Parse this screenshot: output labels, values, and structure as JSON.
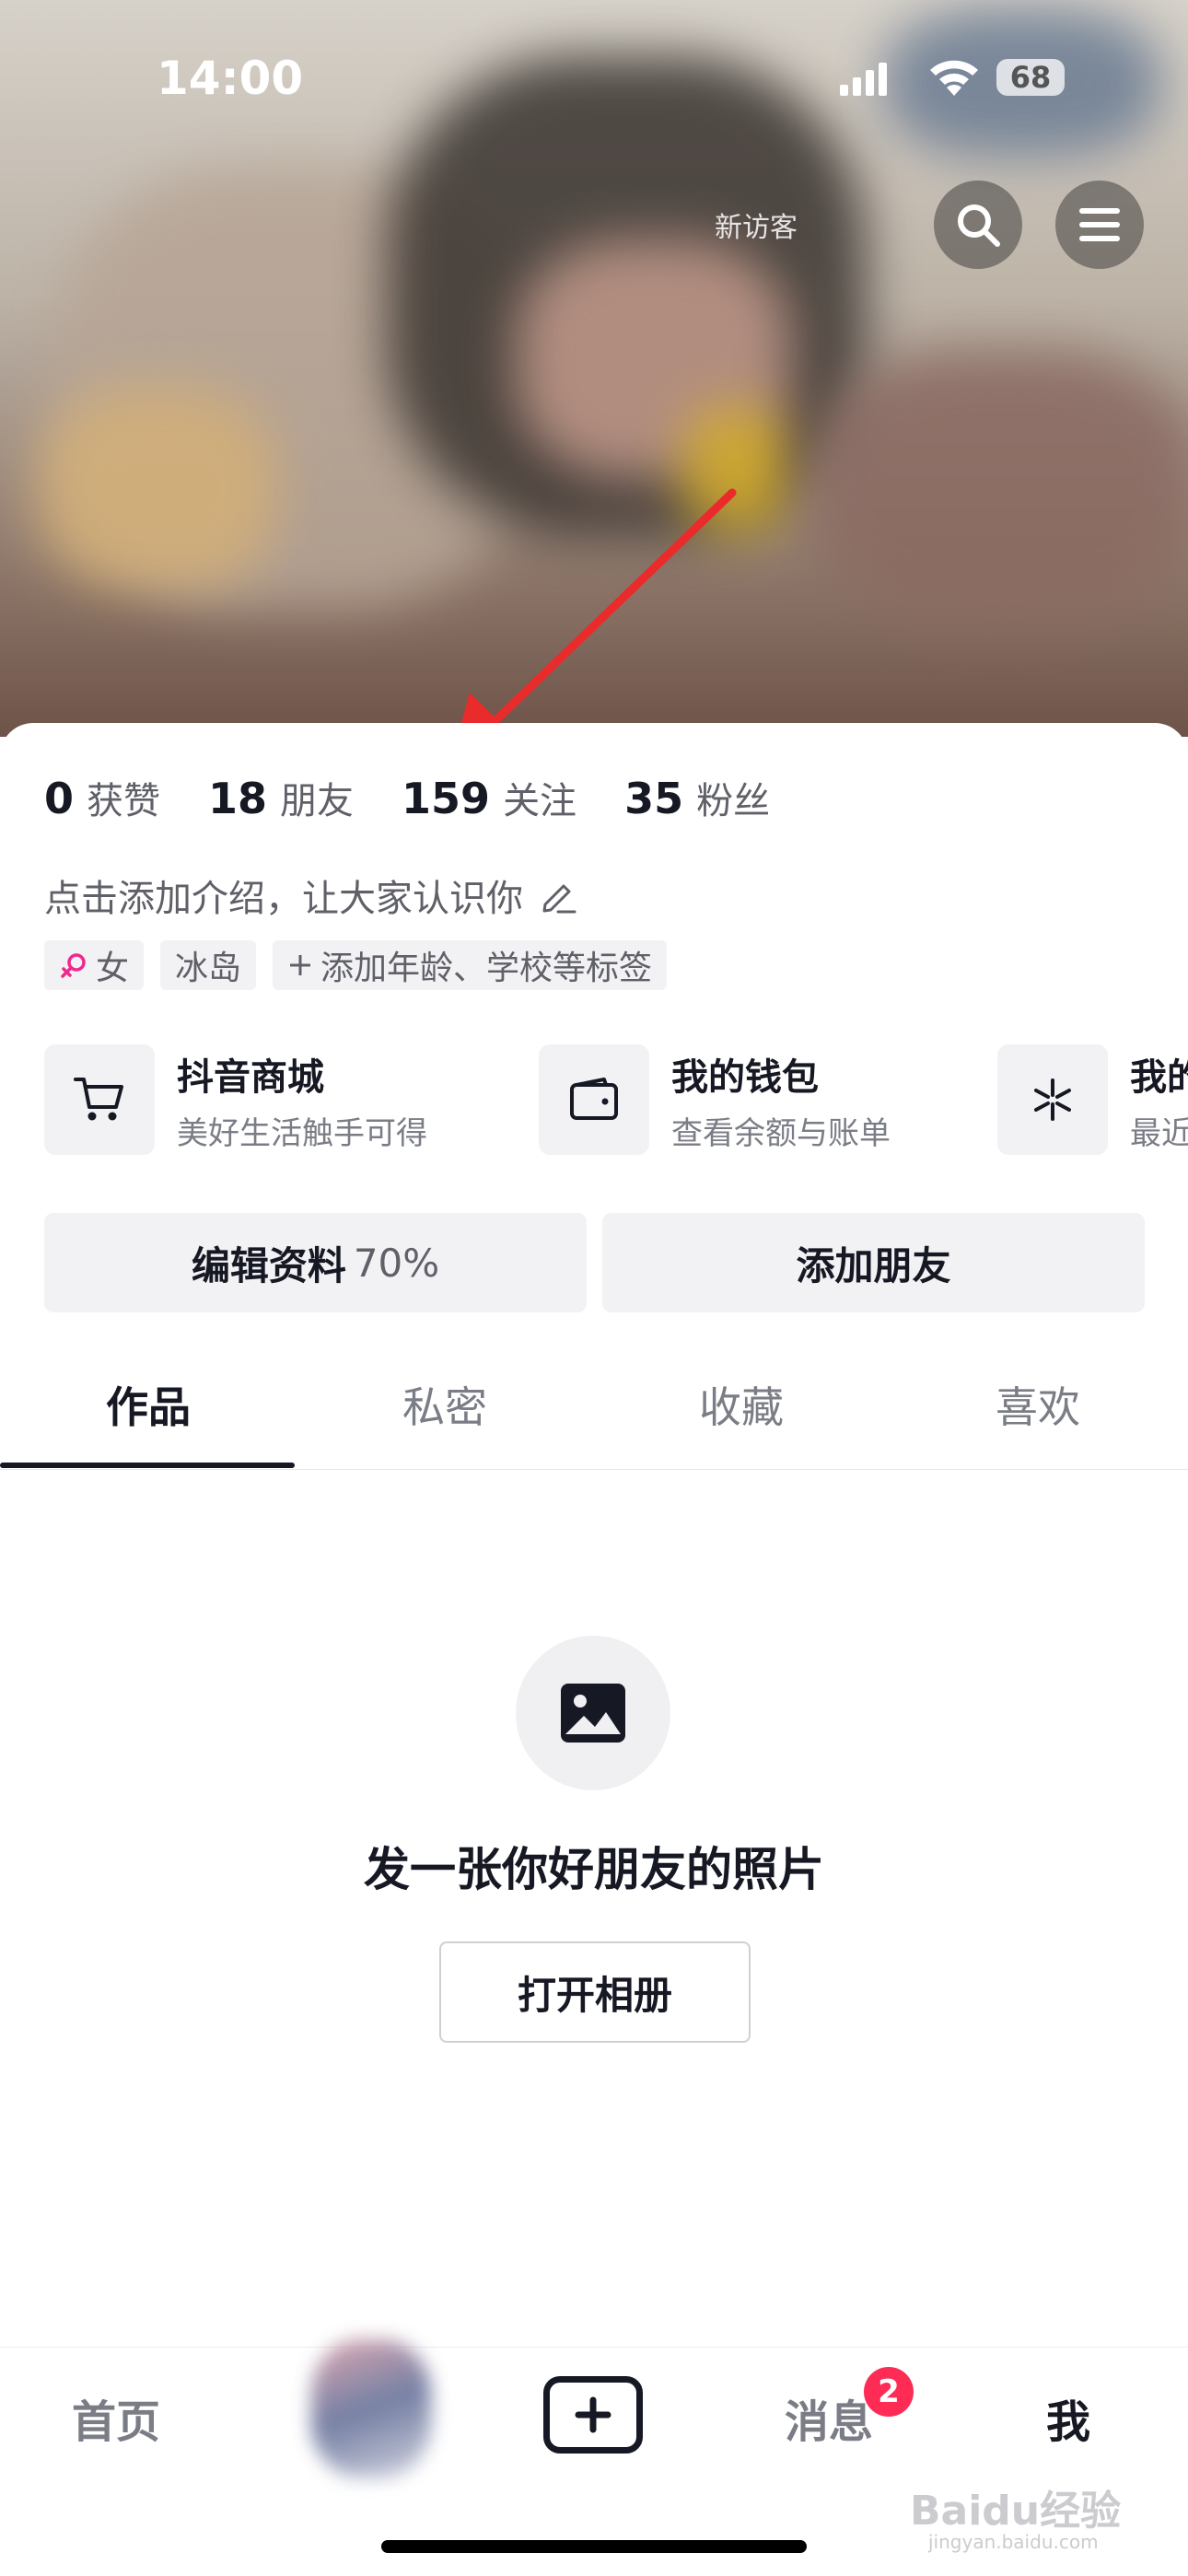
{
  "status_bar": {
    "time": "14:00",
    "battery": "68"
  },
  "header": {
    "visitor_label": "新访客"
  },
  "stats": [
    {
      "value": "0",
      "label": "获赞"
    },
    {
      "value": "18",
      "label": "朋友"
    },
    {
      "value": "159",
      "label": "关注"
    },
    {
      "value": "35",
      "label": "粉丝"
    }
  ],
  "bio": {
    "text": "点击添加介绍，让大家认识你"
  },
  "tags": [
    {
      "label": "女"
    },
    {
      "label": "冰岛"
    },
    {
      "label": "添加年龄、学校等标签"
    }
  ],
  "services": [
    {
      "title": "抖音商城",
      "subtitle": "美好生活触手可得"
    },
    {
      "title": "我的钱包",
      "subtitle": "查看余额与账单"
    },
    {
      "title": "我的",
      "subtitle": "最近"
    }
  ],
  "buttons": {
    "edit_profile": "编辑资料",
    "edit_percent": "70%",
    "add_friend": "添加朋友"
  },
  "tabs": [
    "作品",
    "私密",
    "收藏",
    "喜欢"
  ],
  "empty_state": {
    "message": "发一张你好朋友的照片",
    "button": "打开相册"
  },
  "bottom_nav": {
    "home": "首页",
    "messages": "消息",
    "messages_badge": "2",
    "me": "我"
  },
  "watermark": {
    "brand": "Baidu经验",
    "url": "jingyan.baidu.com"
  }
}
